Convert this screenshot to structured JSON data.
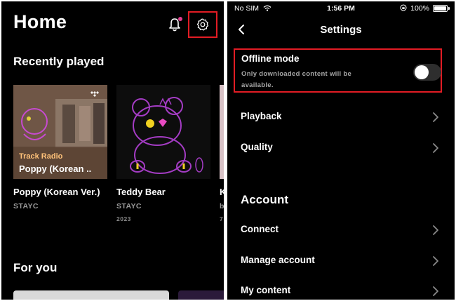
{
  "left": {
    "title": "Home",
    "recently_played_title": "Recently played",
    "cards": [
      {
        "title": "Poppy (Korean Ver.)",
        "subtitle": "STAYC",
        "year": "",
        "radio_label": "Track Radio",
        "radio_name": "Poppy (Korean .."
      },
      {
        "title": "Teddy Bear",
        "subtitle": "STAYC",
        "year": "2023"
      },
      {
        "title": "K",
        "subtitle": "b",
        "year": "7"
      }
    ],
    "for_you_title": "For you",
    "icons": {
      "notifications": "bell-icon",
      "settings": "gear-icon",
      "brand": "tidal-logo-icon"
    },
    "colors": {
      "notification_dot": "#e33c8e",
      "highlight_border": "#e21c24",
      "radio_label": "#ffc27a"
    }
  },
  "right": {
    "status": {
      "carrier": "No SIM",
      "time": "1:56 PM",
      "battery": "100%"
    },
    "nav_title": "Settings",
    "offline": {
      "title": "Offline mode",
      "description": "Only downloaded content will be available.",
      "enabled": false
    },
    "rows_top": [
      {
        "label": "Playback"
      },
      {
        "label": "Quality"
      }
    ],
    "account_title": "Account",
    "rows_account": [
      {
        "label": "Connect"
      },
      {
        "label": "Manage account"
      },
      {
        "label": "My content"
      }
    ]
  }
}
